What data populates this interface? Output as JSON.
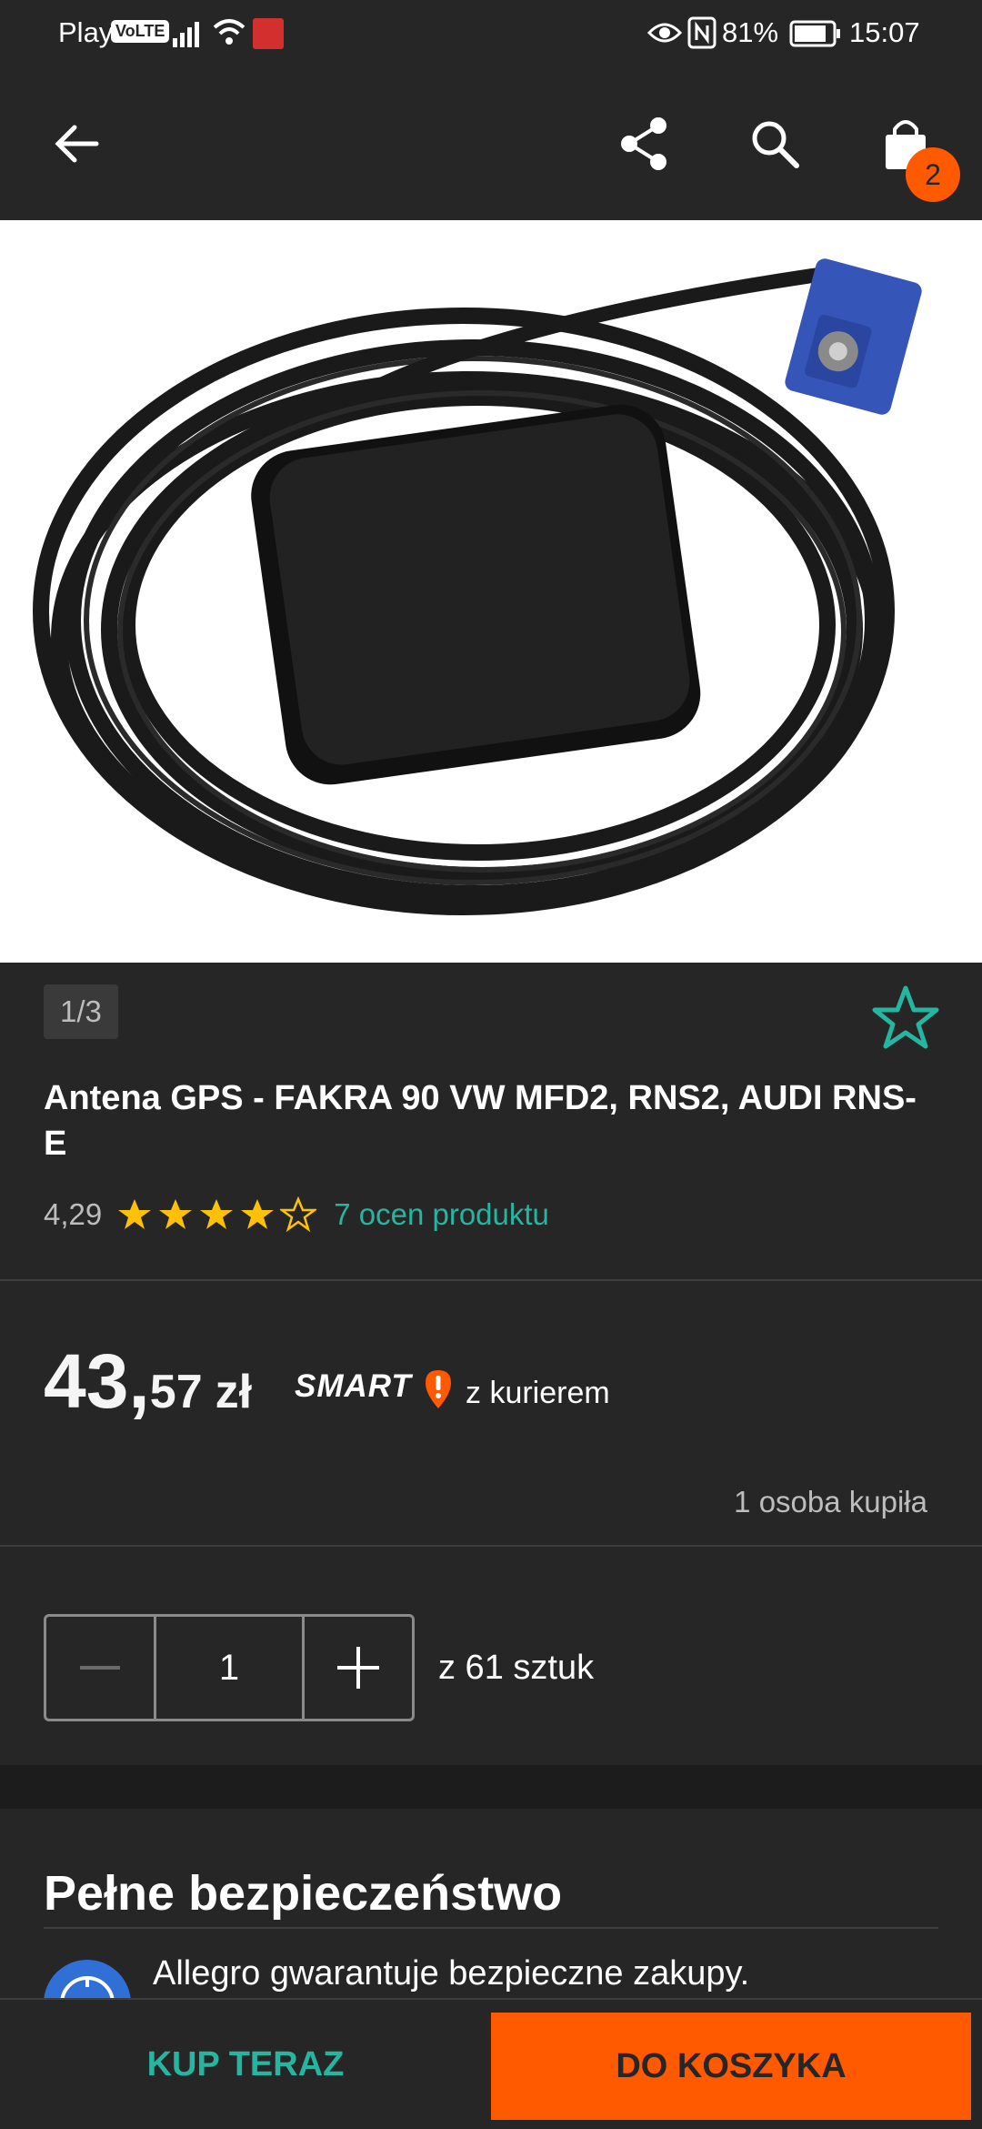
{
  "status_bar": {
    "carrier": "Play",
    "volte": "VoLTE",
    "battery": "81%",
    "time": "15:07"
  },
  "app_bar": {
    "cart_count": "2",
    "icons": [
      "back-arrow-icon",
      "share-icon",
      "search-icon",
      "shopping-bag-icon"
    ]
  },
  "product": {
    "image_counter": "1/3",
    "title": "Antena GPS - FAKRA 90 VW MFD2, RNS2, AUDI RNS-E",
    "rating_value": "4,29",
    "rating_stars": 4.29,
    "ratings_link": "7 ocen produktu",
    "price_main": "43,",
    "price_cents": "57",
    "price_currency": "zł",
    "smart_label": "SMART",
    "delivery": "z kurierem",
    "buyers": "1 osoba kupiła"
  },
  "quantity": {
    "value": "1",
    "stock": "z 61 sztuk"
  },
  "security": {
    "title": "Pełne bezpieczeństwo",
    "text": "Allegro gwarantuje bezpieczne zakupy."
  },
  "bottom_bar": {
    "buy_now": "KUP TERAZ",
    "add_to_cart": "DO KOSZYKA"
  },
  "colors": {
    "accent_teal": "#26b5a0",
    "accent_orange": "#ff5a00",
    "star_yellow": "#ffc107",
    "background": "#262626"
  }
}
